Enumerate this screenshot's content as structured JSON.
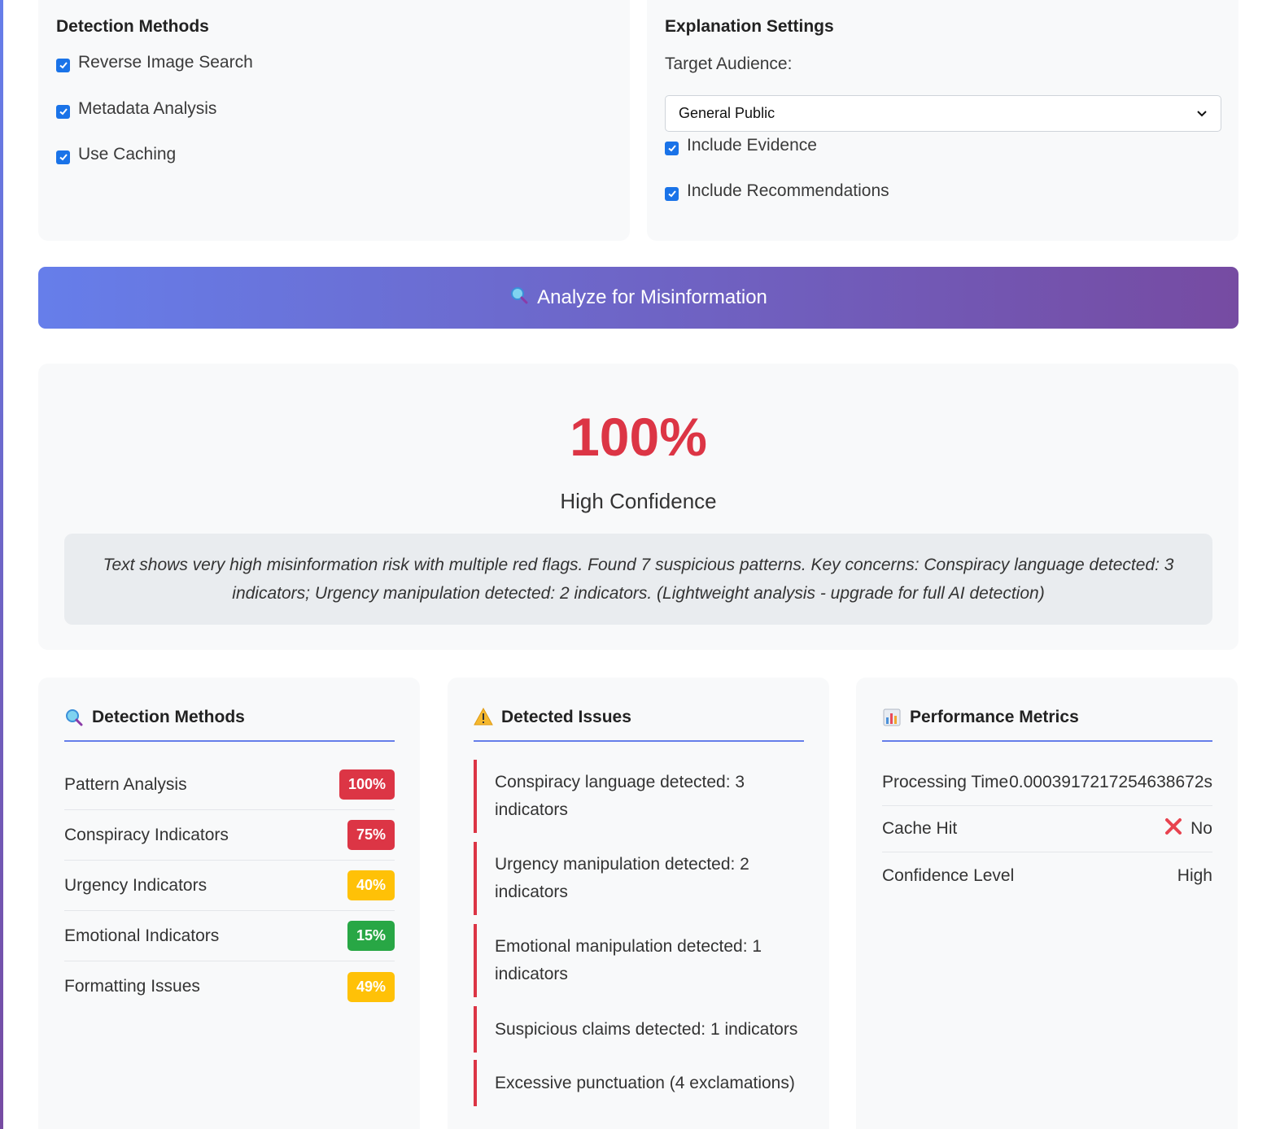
{
  "detection_settings": {
    "title": "Detection Methods",
    "options": [
      {
        "label": "Reverse Image Search",
        "checked": true
      },
      {
        "label": "Metadata Analysis",
        "checked": true
      },
      {
        "label": "Use Caching",
        "checked": true
      }
    ]
  },
  "explanation_settings": {
    "title": "Explanation Settings",
    "audience_label": "Target Audience:",
    "audience_value": "General Public",
    "options": [
      {
        "label": "Include Evidence",
        "checked": true
      },
      {
        "label": "Include Recommendations",
        "checked": true
      }
    ]
  },
  "analyze_button": {
    "label": "Analyze for Misinformation",
    "icon": "search-icon"
  },
  "result": {
    "score": "100%",
    "confidence": "High Confidence",
    "summary": "Text shows very high misinformation risk with multiple red flags. Found 7 suspicious patterns. Key concerns: Conspiracy language detected: 3 indicators; Urgency manipulation detected: 2 indicators. (Lightweight analysis - upgrade for full AI detection)",
    "score_color": "#dc3545"
  },
  "methods_panel": {
    "title": "Detection Methods",
    "icon": "search-icon",
    "rows": [
      {
        "label": "Pattern Analysis",
        "value": "100%",
        "color": "#dc3545"
      },
      {
        "label": "Conspiracy Indicators",
        "value": "75%",
        "color": "#dc3545"
      },
      {
        "label": "Urgency Indicators",
        "value": "40%",
        "color": "#ffc107"
      },
      {
        "label": "Emotional Indicators",
        "value": "15%",
        "color": "#28a745"
      },
      {
        "label": "Formatting Issues",
        "value": "49%",
        "color": "#ffc107"
      }
    ]
  },
  "issues_panel": {
    "title": "Detected Issues",
    "icon": "warning-icon",
    "items": [
      "Conspiracy language detected: 3 indicators",
      "Urgency manipulation detected: 2 indicators",
      "Emotional manipulation detected: 1 indicators",
      "Suspicious claims detected: 1 indicators",
      "Excessive punctuation (4 exclamations)"
    ]
  },
  "metrics_panel": {
    "title": "Performance Metrics",
    "icon": "bar-chart-icon",
    "rows": [
      {
        "label": "Processing Time",
        "value": "0.0003917217254638672s"
      },
      {
        "label": "Cache Hit",
        "value": "No",
        "icon": "cross-mark-icon"
      },
      {
        "label": "Confidence Level",
        "value": "High"
      }
    ]
  },
  "colors": {
    "accent_start": "#667eea",
    "accent_end": "#764ba2",
    "danger": "#dc3545",
    "warning": "#ffc107",
    "success": "#28a745"
  }
}
